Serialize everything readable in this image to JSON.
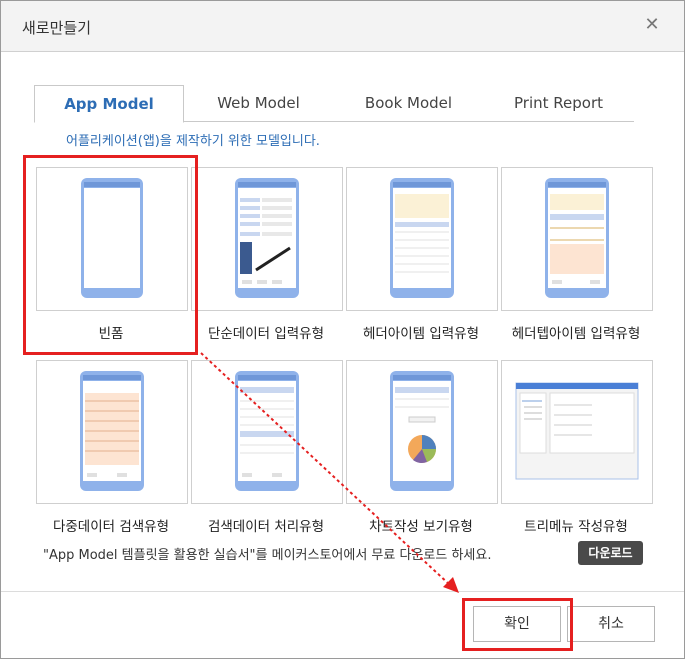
{
  "dialog": {
    "title": "새로만들기",
    "close_icon": "close-icon"
  },
  "tabs": [
    {
      "label": "App Model",
      "active": true
    },
    {
      "label": "Web Model",
      "active": false
    },
    {
      "label": "Book Model",
      "active": false
    },
    {
      "label": "Print Report",
      "active": false
    }
  ],
  "description": "어플리케이션(앱)을 제작하기 위한 모델입니다.",
  "templates": [
    {
      "label": "빈폼",
      "selected": true
    },
    {
      "label": "단순데이터 입력유형"
    },
    {
      "label": "헤더아이템 입력유형"
    },
    {
      "label": "헤더텝아이템 입력유형"
    },
    {
      "label": "다중데이터 검색유형"
    },
    {
      "label": "검색데이터 처리유형"
    },
    {
      "label": "차트작성 보기유형"
    },
    {
      "label": "트리메뉴 작성유형"
    }
  ],
  "notice": "\"App Model 템플릿을 활용한 실습서\"를 메이커스토어에서 무료 다운로드 하세요.",
  "download_label": "다운로드",
  "buttons": {
    "ok": "확인",
    "cancel": "취소"
  },
  "colors": {
    "accent": "#2d6db5",
    "highlight": "#e52020",
    "phone_frame": "#8fb2ea"
  }
}
